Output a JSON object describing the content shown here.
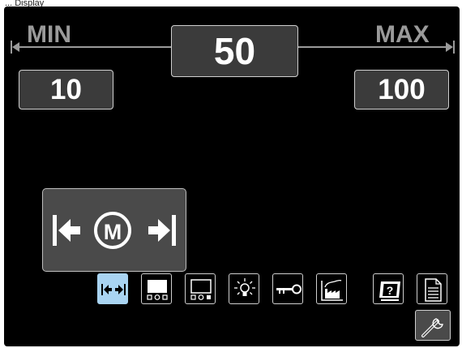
{
  "caption": "... Display",
  "range": {
    "min_label": "MIN",
    "max_label": "MAX",
    "current_value": "50",
    "min_value": "10",
    "max_value": "100"
  },
  "mode_panel": {
    "motor_letter": "M"
  },
  "toolbar": {
    "items": [
      {
        "icon": "run-in-arrows-icon",
        "selected": true
      },
      {
        "icon": "display-dots-icon",
        "selected": false
      },
      {
        "icon": "display-outline-icon",
        "selected": false
      },
      {
        "icon": "light-bulb-icon",
        "selected": false
      },
      {
        "icon": "key-icon",
        "selected": false
      },
      {
        "icon": "factory-icon",
        "selected": false
      },
      {
        "icon": "help-screen-icon",
        "selected": false
      },
      {
        "icon": "document-icon",
        "selected": false
      }
    ],
    "settings_icon": "wrench-icon"
  },
  "colors": {
    "screen_background": "#000000",
    "box_fill": "#3b3b3b",
    "selected_tile": "#a9d4f2",
    "label_gray": "#9a9a9a"
  }
}
